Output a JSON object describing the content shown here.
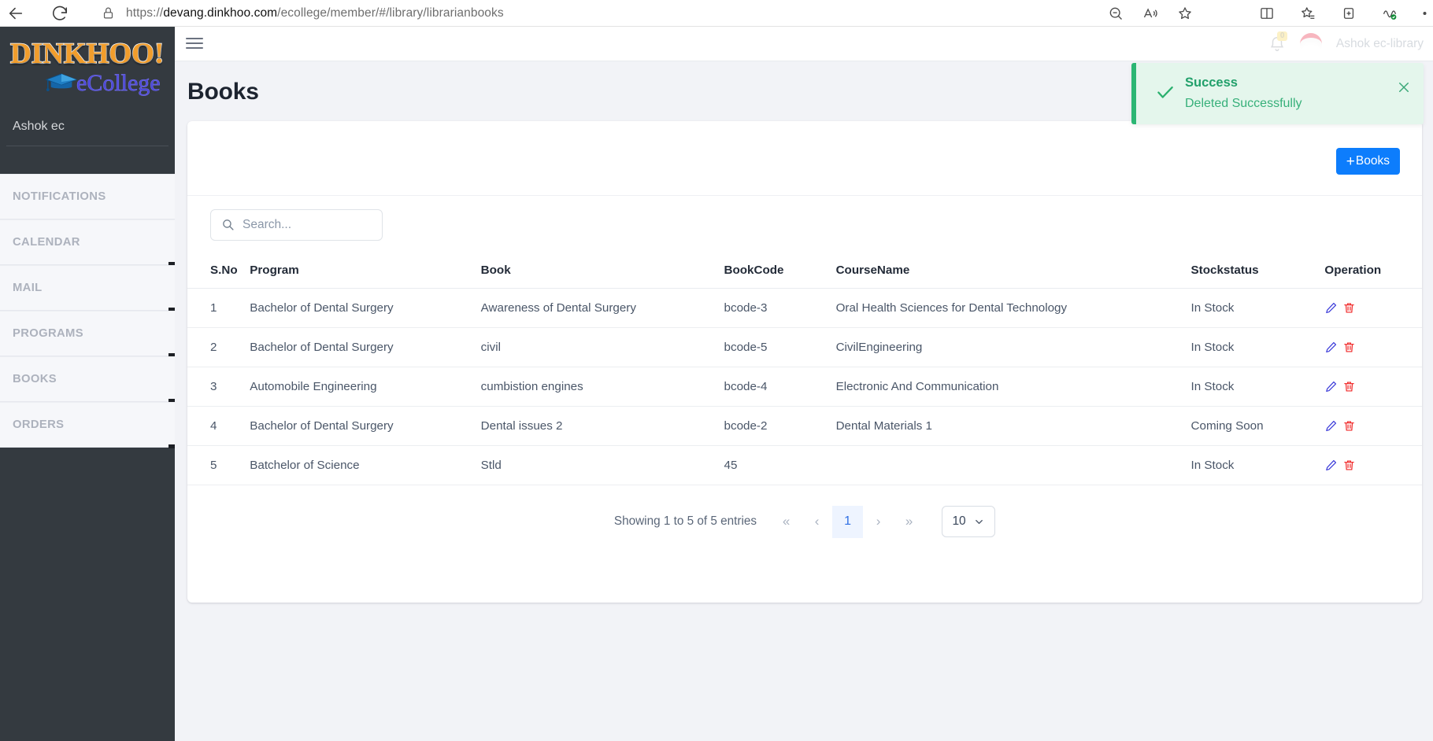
{
  "browser": {
    "url_prefix": "https://",
    "url_domain": "devang.dinkhoo.com",
    "url_path": "/ecollege/member/#/library/librarianbooks",
    "back_icon": "back-arrow-icon",
    "reload_icon": "reload-icon",
    "lock_icon": "lock-icon",
    "icons": [
      "zoom-out-icon",
      "read-aloud-icon",
      "favorite-star-icon",
      "split-screen-icon",
      "collections-icon",
      "add-tab-icon",
      "browser-essentials-icon",
      "settings-more-icon"
    ]
  },
  "sidebar": {
    "logo_word": "DINKHOO!",
    "logo_sub": "eCollege",
    "user": "Ashok ec",
    "items": [
      {
        "label": "NOTIFICATIONS"
      },
      {
        "label": "CALENDAR"
      },
      {
        "label": "MAIL"
      },
      {
        "label": "PROGRAMS"
      },
      {
        "label": "BOOKS"
      },
      {
        "label": "ORDERS"
      }
    ]
  },
  "topbar": {
    "menu_icon": "hamburger-menu-icon",
    "bell_icon": "notification-bell-icon",
    "bell_count": "0",
    "avatar_name": "Ashok ec-library"
  },
  "page": {
    "title": "Books"
  },
  "toolbar": {
    "add_label": "Books",
    "add_plus": "+"
  },
  "search": {
    "placeholder": "Search...",
    "value": "",
    "icon": "search-icon"
  },
  "table": {
    "columns": [
      "S.No",
      "Program",
      "Book",
      "BookCode",
      "CourseName",
      "Stockstatus",
      "Operation"
    ],
    "rows": [
      {
        "sno": "1",
        "program": "Bachelor of Dental Surgery",
        "book": "Awareness of Dental Surgery",
        "bookcode": "bcode-3",
        "coursename": "Oral Health Sciences for Dental Technology",
        "stockstatus": "In Stock"
      },
      {
        "sno": "2",
        "program": "Bachelor of Dental Surgery",
        "book": "civil",
        "bookcode": "bcode-5",
        "coursename": "CivilEngineering",
        "stockstatus": "In Stock"
      },
      {
        "sno": "3",
        "program": "Automobile Engineering",
        "book": "cumbistion engines",
        "bookcode": "bcode-4",
        "coursename": "Electronic And Communication",
        "stockstatus": "In Stock"
      },
      {
        "sno": "4",
        "program": "Bachelor of Dental Surgery",
        "book": "Dental issues 2",
        "bookcode": "bcode-2",
        "coursename": "Dental Materials 1",
        "stockstatus": "Coming Soon"
      },
      {
        "sno": "5",
        "program": "Batchelor of Science",
        "book": "Stld",
        "bookcode": "45",
        "coursename": "",
        "stockstatus": "In Stock"
      }
    ],
    "edit_icon": "edit-pencil-icon",
    "delete_icon": "delete-trash-icon"
  },
  "pagination": {
    "info": "Showing 1 to 5 of 5 entries",
    "first": "«",
    "prev": "‹",
    "current_page": "1",
    "next": "›",
    "last": "»",
    "page_size": "10"
  },
  "toast": {
    "title": "Success",
    "message": "Deleted Successfully",
    "check_icon": "check-icon",
    "close_icon": "close-icon"
  },
  "colors": {
    "sidebar_bg": "#343a40",
    "accent_blue": "#0d7dfc",
    "toast_green": "#2bb673",
    "delete_red": "#f02626",
    "edit_blue": "#3b3bd9",
    "logo_orange": "#f19d2c",
    "logo_purple": "#4a46d6"
  }
}
